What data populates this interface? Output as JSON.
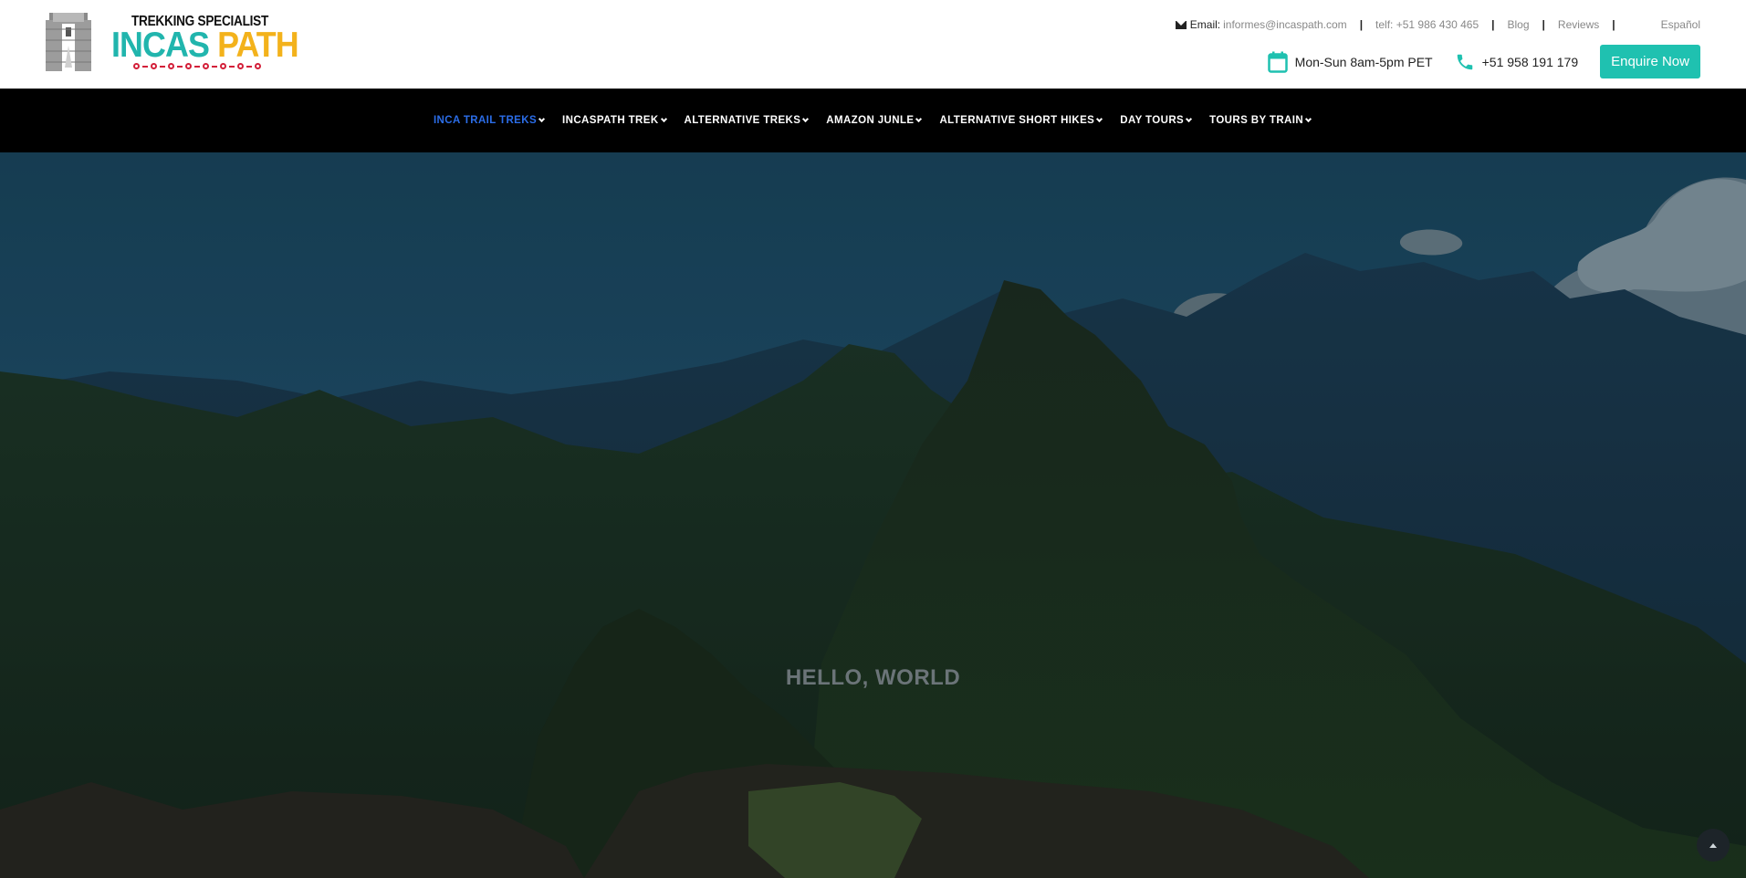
{
  "brand": {
    "tagline": "TREKKING SPECIALIST",
    "name_part1": "INCAS",
    "name_part2": "PATH",
    "colors": {
      "teal": "#21b5ad",
      "gold": "#f3b21b",
      "red": "#d3203a"
    }
  },
  "topbar": {
    "email_icon": "envelope-icon",
    "email_label": "Email:",
    "email_value": "informes@incaspath.com",
    "telf": "telf: +51 986 430 465",
    "blog": "Blog",
    "reviews": "Reviews",
    "language": "Español"
  },
  "contact": {
    "hours_icon": "calendar-icon",
    "hours": "Mon-Sun 8am-5pm PET",
    "phone_icon": "phone-icon",
    "phone": "+51 958 191 179",
    "cta": "Enquire Now",
    "accent": "#1fc1b0"
  },
  "nav": {
    "items": [
      {
        "label": "INCA TRAIL TREKS",
        "active": true
      },
      {
        "label": "INCASPATH TREK",
        "active": false
      },
      {
        "label": "ALTERNATIVE TREKS",
        "active": false
      },
      {
        "label": "AMAZON JUNLE",
        "active": false
      },
      {
        "label": "ALTERNATIVE SHORT HIKES",
        "active": false
      },
      {
        "label": "DAY TOURS",
        "active": false
      },
      {
        "label": "TOURS BY TRAIN",
        "active": false
      }
    ],
    "active_color": "#2b6de8"
  },
  "hero": {
    "heading": "HELLO, WORLD",
    "back_to_top_icon": "chevron-up-icon"
  }
}
